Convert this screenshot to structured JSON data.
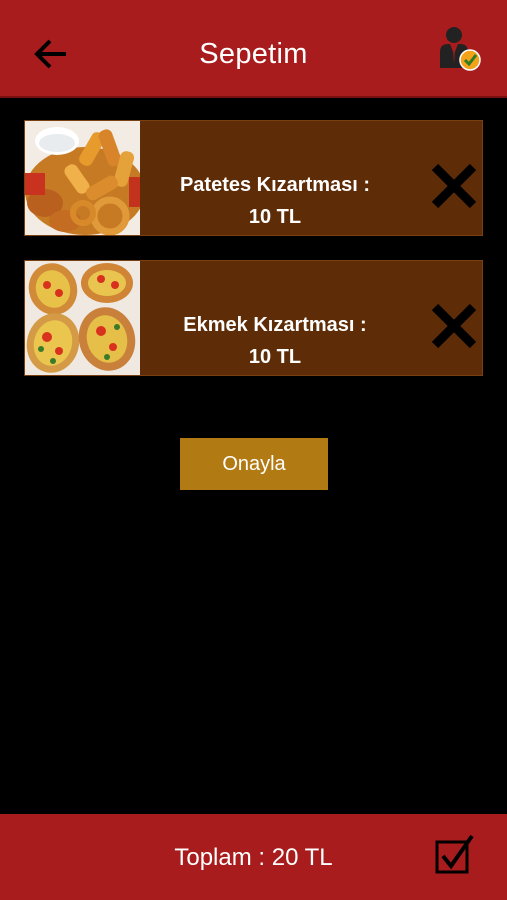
{
  "header": {
    "title": "Sepetim",
    "back_icon": "arrow-left-icon",
    "user_icon": "user-verified-icon"
  },
  "cart": {
    "items": [
      {
        "name": "Patetes Kızartması :",
        "price": "10 TL",
        "image": "fries-photo",
        "remove_icon": "close-icon"
      },
      {
        "name": "Ekmek Kızartması :",
        "price": "10 TL",
        "image": "bread-pizza-photo",
        "remove_icon": "close-icon"
      }
    ]
  },
  "actions": {
    "confirm_label": "Onayla"
  },
  "footer": {
    "total": "Toplam : 20 TL",
    "check_icon": "checkbox-checked-icon"
  },
  "colors": {
    "bar": "#a81c1d",
    "item_bg": "#5e2d08",
    "button": "#b27a13",
    "background": "#000000"
  }
}
